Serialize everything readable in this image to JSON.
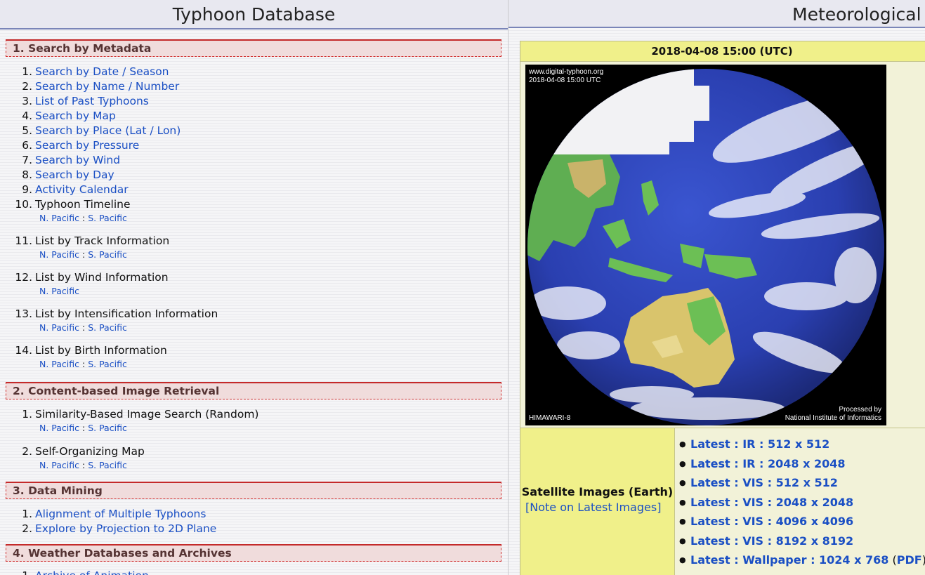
{
  "left": {
    "title": "Typhoon Database",
    "sections": [
      {
        "heading": "1. Search by Metadata",
        "items": [
          {
            "num": "1.",
            "label": "Search by Date / Season"
          },
          {
            "num": "2.",
            "label": "Search by Name / Number"
          },
          {
            "num": "3.",
            "label": "List of Past Typhoons"
          },
          {
            "num": "4.",
            "label": "Search by Map"
          },
          {
            "num": "5.",
            "label": "Search by Place (Lat / Lon)"
          },
          {
            "num": "6.",
            "label": "Search by Pressure"
          },
          {
            "num": "7.",
            "label": "Search by Wind"
          },
          {
            "num": "8.",
            "label": "Search by Day"
          },
          {
            "num": "9.",
            "label": "Activity Calendar"
          },
          {
            "num": "10.",
            "label": "Typhoon Timeline",
            "sub": [
              "N. Pacific",
              "S. Pacific"
            ]
          },
          {
            "num": "11.",
            "label": "List by Track Information",
            "sub": [
              "N. Pacific",
              "S. Pacific"
            ]
          },
          {
            "num": "12.",
            "label": "List by Wind Information",
            "sub": [
              "N. Pacific"
            ]
          },
          {
            "num": "13.",
            "label": "List by Intensification Information",
            "sub": [
              "N. Pacific",
              "S. Pacific"
            ]
          },
          {
            "num": "14.",
            "label": "List by Birth Information",
            "sub": [
              "N. Pacific",
              "S. Pacific"
            ]
          }
        ]
      },
      {
        "heading": "2. Content-based Image Retrieval",
        "items": [
          {
            "num": "1.",
            "label": "Similarity-Based Image Search (Random)",
            "sub": [
              "N. Pacific",
              "S. Pacific"
            ]
          },
          {
            "num": "2.",
            "label": "Self-Organizing Map",
            "sub": [
              "N. Pacific",
              "S. Pacific"
            ]
          }
        ]
      },
      {
        "heading": "3. Data Mining",
        "items": [
          {
            "num": "1.",
            "label": "Alignment of Multiple Typhoons"
          },
          {
            "num": "2.",
            "label": "Explore by Projection to 2D Plane"
          }
        ]
      },
      {
        "heading": "4. Weather Databases and Archives",
        "items": [
          {
            "num": "1.",
            "label": "Archive of Animation"
          }
        ]
      }
    ],
    "sub_separator": " : "
  },
  "right": {
    "title": "Meteorological Satellite",
    "datetime": "2018-04-08 15:00 (UTC)",
    "image_overlay": {
      "site": "www.digital-typhoon.org",
      "timestamp": "2018-04-08 15:00 UTC",
      "satellite": "HIMAWARI-8",
      "processed_line1": "Processed by",
      "processed_line2": "National Institute of Informatics"
    },
    "satellite_label": "Satellite Images (Earth)",
    "note_link": "[Note on Latest Images]",
    "latest_links": [
      "Latest : IR : 512 x 512",
      "Latest : IR : 2048 x 2048",
      "Latest : VIS : 512 x 512",
      "Latest : VIS : 2048 x 2048",
      "Latest : VIS : 4096 x 4096",
      "Latest : VIS : 8192 x 8192",
      "Latest : Wallpaper : 1024 x 768"
    ],
    "pdf_open": " (",
    "pdf_label": "PDF",
    "pdf_close": ")"
  },
  "colors": {
    "link": "#1a4fc4",
    "section_bg": "#f0dcdc",
    "section_border": "#c42a2a",
    "table_header_bg": "#f0f08a",
    "ocean": "#2a3fb0"
  }
}
